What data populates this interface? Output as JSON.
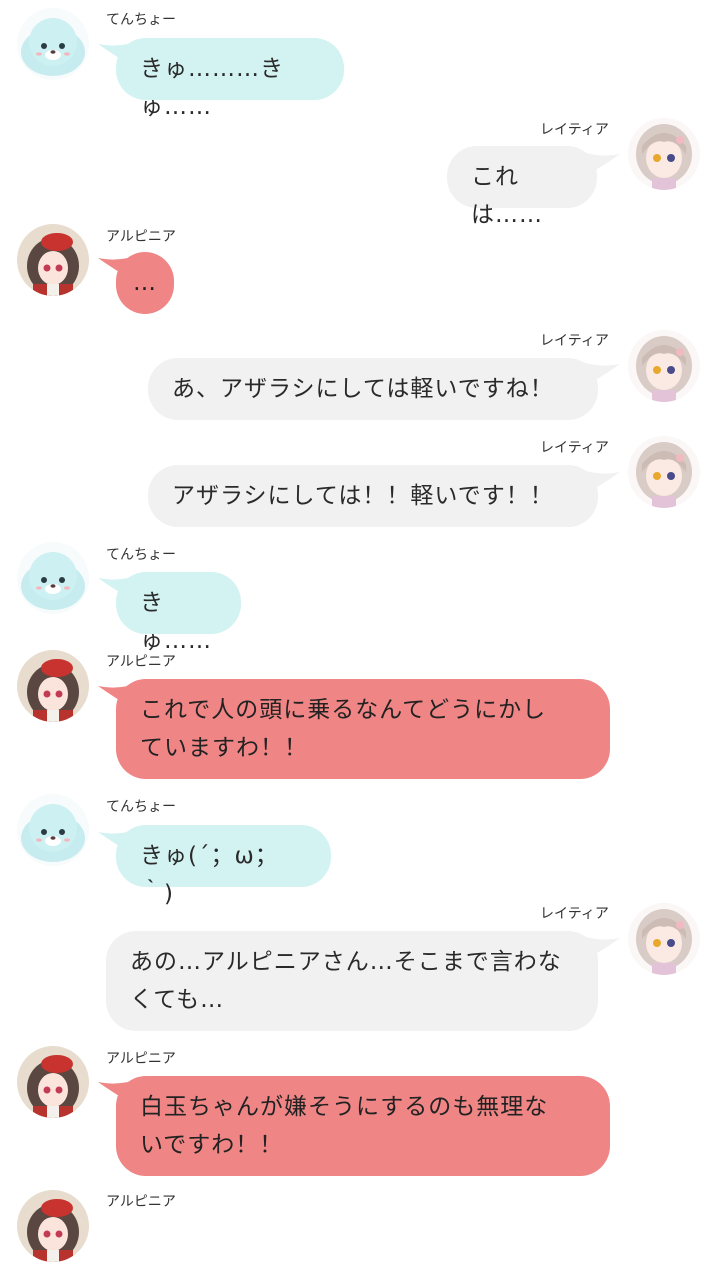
{
  "colors": {
    "seal_bubble": "#d3f2f2",
    "alpinia_bubble": "#f08585",
    "reitia_bubble": "#f1f1f1"
  },
  "messages": [
    {
      "speaker": "てんちょー",
      "side": "left",
      "avatar": "seal-avatar-icon",
      "text": "きゅ………きゅ……"
    },
    {
      "speaker": "レイティア",
      "side": "right",
      "avatar": "reitia-avatar-icon",
      "text": "これは……"
    },
    {
      "speaker": "アルピニア",
      "side": "left",
      "avatar": "alpinia-avatar-icon",
      "text": "…"
    },
    {
      "speaker": "レイティア",
      "side": "right",
      "avatar": "reitia-avatar-icon",
      "text": "あ、アザラシにしては軽いですね！"
    },
    {
      "speaker": "レイティア",
      "side": "right",
      "avatar": "reitia-avatar-icon",
      "text": "アザラシにしては！！軽いです！！"
    },
    {
      "speaker": "てんちょー",
      "side": "left",
      "avatar": "seal-avatar-icon",
      "text": "きゅ……"
    },
    {
      "speaker": "アルピニア",
      "side": "left",
      "avatar": "alpinia-avatar-icon",
      "lines": [
        "これで人の頭に乗るなんてどうにかし",
        "ていますわ！！"
      ]
    },
    {
      "speaker": "てんちょー",
      "side": "left",
      "avatar": "seal-avatar-icon",
      "text": "きゅ(´；ω；｀)"
    },
    {
      "speaker": "レイティア",
      "side": "right",
      "avatar": "reitia-avatar-icon",
      "lines": [
        "あの…アルピニアさん…そこまで言わな",
        "くても…"
      ]
    },
    {
      "speaker": "アルピニア",
      "side": "left",
      "avatar": "alpinia-avatar-icon",
      "lines": [
        "白玉ちゃんが嫌そうにするのも無理な",
        "いですわ！！"
      ]
    },
    {
      "speaker": "アルピニア",
      "side": "left",
      "avatar": "alpinia-avatar-icon"
    }
  ]
}
